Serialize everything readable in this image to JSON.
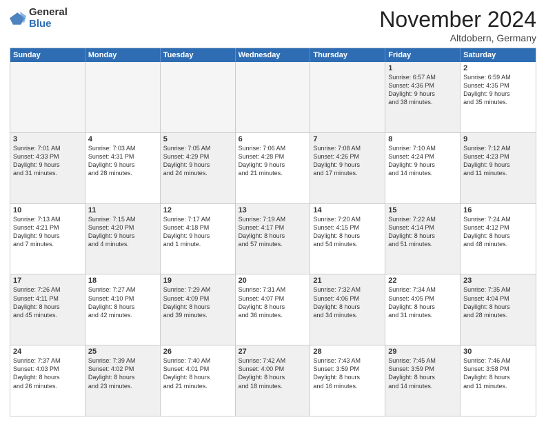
{
  "logo": {
    "general": "General",
    "blue": "Blue"
  },
  "title": "November 2024",
  "location": "Altdobern, Germany",
  "days": [
    "Sunday",
    "Monday",
    "Tuesday",
    "Wednesday",
    "Thursday",
    "Friday",
    "Saturday"
  ],
  "rows": [
    [
      {
        "day": "",
        "text": "",
        "empty": true
      },
      {
        "day": "",
        "text": "",
        "empty": true
      },
      {
        "day": "",
        "text": "",
        "empty": true
      },
      {
        "day": "",
        "text": "",
        "empty": true
      },
      {
        "day": "",
        "text": "",
        "empty": true
      },
      {
        "day": "1",
        "text": "Sunrise: 6:57 AM\nSunset: 4:36 PM\nDaylight: 9 hours\nand 38 minutes.",
        "shaded": true
      },
      {
        "day": "2",
        "text": "Sunrise: 6:59 AM\nSunset: 4:35 PM\nDaylight: 9 hours\nand 35 minutes.",
        "shaded": false
      }
    ],
    [
      {
        "day": "3",
        "text": "Sunrise: 7:01 AM\nSunset: 4:33 PM\nDaylight: 9 hours\nand 31 minutes.",
        "shaded": true
      },
      {
        "day": "4",
        "text": "Sunrise: 7:03 AM\nSunset: 4:31 PM\nDaylight: 9 hours\nand 28 minutes.",
        "shaded": false
      },
      {
        "day": "5",
        "text": "Sunrise: 7:05 AM\nSunset: 4:29 PM\nDaylight: 9 hours\nand 24 minutes.",
        "shaded": true
      },
      {
        "day": "6",
        "text": "Sunrise: 7:06 AM\nSunset: 4:28 PM\nDaylight: 9 hours\nand 21 minutes.",
        "shaded": false
      },
      {
        "day": "7",
        "text": "Sunrise: 7:08 AM\nSunset: 4:26 PM\nDaylight: 9 hours\nand 17 minutes.",
        "shaded": true
      },
      {
        "day": "8",
        "text": "Sunrise: 7:10 AM\nSunset: 4:24 PM\nDaylight: 9 hours\nand 14 minutes.",
        "shaded": false
      },
      {
        "day": "9",
        "text": "Sunrise: 7:12 AM\nSunset: 4:23 PM\nDaylight: 9 hours\nand 11 minutes.",
        "shaded": true
      }
    ],
    [
      {
        "day": "10",
        "text": "Sunrise: 7:13 AM\nSunset: 4:21 PM\nDaylight: 9 hours\nand 7 minutes.",
        "shaded": false
      },
      {
        "day": "11",
        "text": "Sunrise: 7:15 AM\nSunset: 4:20 PM\nDaylight: 9 hours\nand 4 minutes.",
        "shaded": true
      },
      {
        "day": "12",
        "text": "Sunrise: 7:17 AM\nSunset: 4:18 PM\nDaylight: 9 hours\nand 1 minute.",
        "shaded": false
      },
      {
        "day": "13",
        "text": "Sunrise: 7:19 AM\nSunset: 4:17 PM\nDaylight: 8 hours\nand 57 minutes.",
        "shaded": true
      },
      {
        "day": "14",
        "text": "Sunrise: 7:20 AM\nSunset: 4:15 PM\nDaylight: 8 hours\nand 54 minutes.",
        "shaded": false
      },
      {
        "day": "15",
        "text": "Sunrise: 7:22 AM\nSunset: 4:14 PM\nDaylight: 8 hours\nand 51 minutes.",
        "shaded": true
      },
      {
        "day": "16",
        "text": "Sunrise: 7:24 AM\nSunset: 4:12 PM\nDaylight: 8 hours\nand 48 minutes.",
        "shaded": false
      }
    ],
    [
      {
        "day": "17",
        "text": "Sunrise: 7:26 AM\nSunset: 4:11 PM\nDaylight: 8 hours\nand 45 minutes.",
        "shaded": true
      },
      {
        "day": "18",
        "text": "Sunrise: 7:27 AM\nSunset: 4:10 PM\nDaylight: 8 hours\nand 42 minutes.",
        "shaded": false
      },
      {
        "day": "19",
        "text": "Sunrise: 7:29 AM\nSunset: 4:09 PM\nDaylight: 8 hours\nand 39 minutes.",
        "shaded": true
      },
      {
        "day": "20",
        "text": "Sunrise: 7:31 AM\nSunset: 4:07 PM\nDaylight: 8 hours\nand 36 minutes.",
        "shaded": false
      },
      {
        "day": "21",
        "text": "Sunrise: 7:32 AM\nSunset: 4:06 PM\nDaylight: 8 hours\nand 34 minutes.",
        "shaded": true
      },
      {
        "day": "22",
        "text": "Sunrise: 7:34 AM\nSunset: 4:05 PM\nDaylight: 8 hours\nand 31 minutes.",
        "shaded": false
      },
      {
        "day": "23",
        "text": "Sunrise: 7:35 AM\nSunset: 4:04 PM\nDaylight: 8 hours\nand 28 minutes.",
        "shaded": true
      }
    ],
    [
      {
        "day": "24",
        "text": "Sunrise: 7:37 AM\nSunset: 4:03 PM\nDaylight: 8 hours\nand 26 minutes.",
        "shaded": false
      },
      {
        "day": "25",
        "text": "Sunrise: 7:39 AM\nSunset: 4:02 PM\nDaylight: 8 hours\nand 23 minutes.",
        "shaded": true
      },
      {
        "day": "26",
        "text": "Sunrise: 7:40 AM\nSunset: 4:01 PM\nDaylight: 8 hours\nand 21 minutes.",
        "shaded": false
      },
      {
        "day": "27",
        "text": "Sunrise: 7:42 AM\nSunset: 4:00 PM\nDaylight: 8 hours\nand 18 minutes.",
        "shaded": true
      },
      {
        "day": "28",
        "text": "Sunrise: 7:43 AM\nSunset: 3:59 PM\nDaylight: 8 hours\nand 16 minutes.",
        "shaded": false
      },
      {
        "day": "29",
        "text": "Sunrise: 7:45 AM\nSunset: 3:59 PM\nDaylight: 8 hours\nand 14 minutes.",
        "shaded": true
      },
      {
        "day": "30",
        "text": "Sunrise: 7:46 AM\nSunset: 3:58 PM\nDaylight: 8 hours\nand 11 minutes.",
        "shaded": false
      }
    ]
  ]
}
